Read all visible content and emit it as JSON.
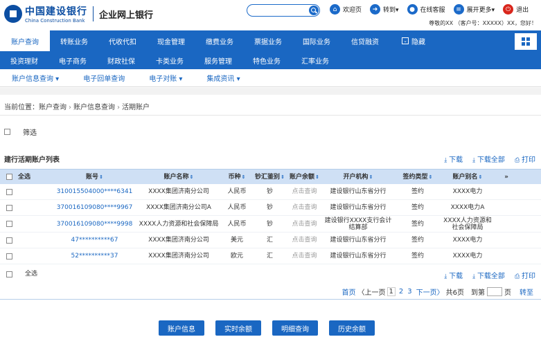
{
  "header": {
    "logo_cn": "中国建设银行",
    "logo_en": "China Construction Bank",
    "site_title": "企业网上银行",
    "links": [
      {
        "label": "欢迎页",
        "icon": "home-icon"
      },
      {
        "label": "转到▾",
        "icon": "arrow-right-icon"
      },
      {
        "label": "在线客服",
        "icon": "user-icon"
      },
      {
        "label": "展开更多▾",
        "icon": "menu-icon"
      },
      {
        "label": "退出",
        "icon": "power-icon"
      }
    ],
    "welcome": "尊敬的XX （客户号：XXXXX）XX，您好！"
  },
  "nav1": [
    "账户查询",
    "转账业务",
    "代收代扣",
    "现金管理",
    "缴费业务",
    "票据业务",
    "国际业务",
    "信贷融资",
    "隐藏"
  ],
  "nav2": [
    "投资理财",
    "电子商务",
    "财政社保",
    "卡类业务",
    "服务管理",
    "特色业务",
    "汇率业务"
  ],
  "subnav": [
    "账户信息查询 ▾",
    "电子回单查询",
    "电子对账 ▾",
    "集成资讯 ▾"
  ],
  "breadcrumb": {
    "prefix": "当前位置：",
    "items": [
      "账户查询",
      "账户信息查询",
      "活期账户"
    ]
  },
  "filter_label": "筛选",
  "list_title": "建行活期账户列表",
  "actions": {
    "download": "下载",
    "download_all": "下载全部",
    "print": "打印"
  },
  "table": {
    "headers": [
      "全选",
      "账号",
      "账户名称",
      "币种",
      "钞汇鉴别",
      "账户余额",
      "开户机构",
      "签约类型",
      "账户别名",
      "»"
    ],
    "rows": [
      {
        "account": "310015504000****6341",
        "name": "XXXX集团济南分公司",
        "currency": "人民币",
        "type": "钞",
        "balance": "点击查询",
        "branch": "建设银行山东省分行",
        "sign": "签约",
        "alias": "XXXX电力"
      },
      {
        "account": "370016109080****9967",
        "name": "XXXX集团济南分公司A",
        "currency": "人民币",
        "type": "钞",
        "balance": "点击查询",
        "branch": "建设银行山东省分行",
        "sign": "签约",
        "alias": "XXXX电力A"
      },
      {
        "account": "370016109080****9998",
        "name": "XXXX人力资源和社会保障局",
        "currency": "人民币",
        "type": "钞",
        "balance": "点击查询",
        "branch": "建设银行XXXX支行会计结算部",
        "sign": "签约",
        "alias": "XXXX人力资源和社会保障局"
      },
      {
        "account": "47**********67",
        "name": "XXXX集团济南分公司",
        "currency": "美元",
        "type": "汇",
        "balance": "点击查询",
        "branch": "建设银行山东省分行",
        "sign": "签约",
        "alias": "XXXX电力"
      },
      {
        "account": "52**********37",
        "name": "XXXX集团济南分公司",
        "currency": "欧元",
        "type": "汇",
        "balance": "点击查询",
        "branch": "建设银行山东省分行",
        "sign": "签约",
        "alias": "XXXX电力"
      }
    ]
  },
  "footer_select_all": "全选",
  "pager": {
    "first": "首页",
    "prev": "〈上一页",
    "current": "1",
    "p2": "2",
    "p3": "3",
    "next": "下一页〉",
    "total": "共6页",
    "goto_prefix": "到第",
    "goto_suffix": "页",
    "go": "转至"
  },
  "bottom_buttons": [
    "账户信息",
    "实时余额",
    "明细查询",
    "历史余额"
  ]
}
